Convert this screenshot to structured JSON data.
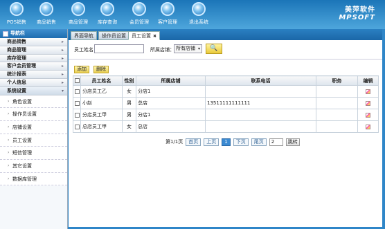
{
  "topbar": {
    "buttons": [
      {
        "label": "POS销售",
        "icon": "pos-icon"
      },
      {
        "label": "商品销售",
        "icon": "sales-icon"
      },
      {
        "label": "商品管理",
        "icon": "goods-icon"
      },
      {
        "label": "库存查询",
        "icon": "search-icon"
      },
      {
        "label": "会员管理",
        "icon": "member-icon"
      },
      {
        "label": "客户管理",
        "icon": "customer-icon"
      },
      {
        "label": "退出系统",
        "icon": "exit-icon"
      }
    ],
    "brand_cn": "美萍软件",
    "brand_en": "MPSOFT"
  },
  "sidebar": {
    "title": "导航栏",
    "items": [
      {
        "label": "商品销售"
      },
      {
        "label": "商品管理"
      },
      {
        "label": "库存管理"
      },
      {
        "label": "客户会员管理"
      },
      {
        "label": "统计报表"
      },
      {
        "label": "个人信息"
      },
      {
        "label": "系统设置"
      }
    ],
    "subitems": [
      {
        "label": "角色设置"
      },
      {
        "label": "操作员设置"
      },
      {
        "label": "店铺设置"
      },
      {
        "label": "员工设置"
      },
      {
        "label": "短信管理"
      },
      {
        "label": "其它设置"
      },
      {
        "label": "数据库管理"
      }
    ]
  },
  "tabs": [
    {
      "label": "界面导航"
    },
    {
      "label": "操作员设置"
    },
    {
      "label": "员工设置"
    }
  ],
  "search": {
    "name_label": "员工姓名：",
    "name_value": "",
    "store_label": "所属店铺：",
    "store_value": "所有店铺"
  },
  "actions": {
    "add": "添加",
    "delete": "删除"
  },
  "table": {
    "headers": [
      "员工姓名",
      "性别",
      "所属店铺",
      "联系电话",
      "职务",
      "编辑"
    ],
    "rows": [
      {
        "name": "分店员工乙",
        "gender": "女",
        "store": "分店1",
        "phone": "",
        "job": ""
      },
      {
        "name": "小赵",
        "gender": "男",
        "store": "总店",
        "phone": "13511111111111",
        "job": ""
      },
      {
        "name": "分店员工甲",
        "gender": "男",
        "store": "分店1",
        "phone": "",
        "job": ""
      },
      {
        "name": "总店员工甲",
        "gender": "女",
        "store": "总店",
        "phone": "",
        "job": ""
      }
    ]
  },
  "pager": {
    "info": "第1/1页",
    "first": "首页",
    "prev": "上页",
    "current": "1",
    "next": "下页",
    "last": "尾页",
    "jump_value": "2",
    "jump": "跳转"
  }
}
